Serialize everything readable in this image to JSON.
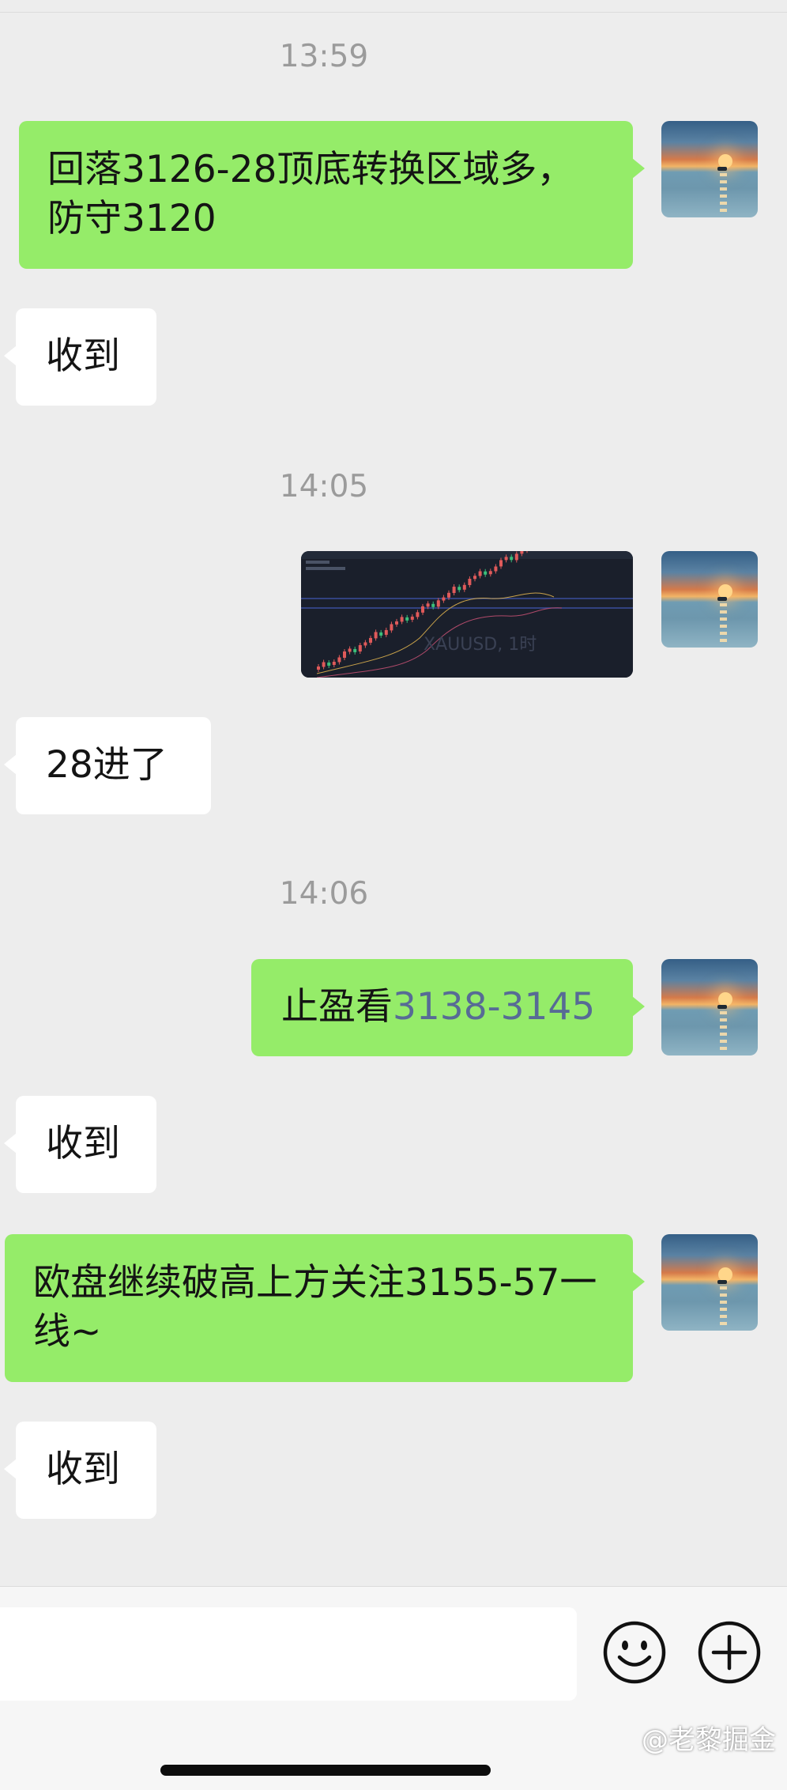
{
  "messages": [
    {
      "type": "time",
      "text": "13:59"
    },
    {
      "type": "outgoing",
      "text": "回落3126-28顶底转换区域多，防守3120"
    },
    {
      "type": "incoming",
      "text": "收到"
    },
    {
      "type": "time",
      "text": "14:05"
    },
    {
      "type": "outgoing-image",
      "symbol": "XAUUSD",
      "timeframe": "1时"
    },
    {
      "type": "incoming",
      "text": "28进了"
    },
    {
      "type": "time",
      "text": "14:06"
    },
    {
      "type": "outgoing",
      "text": "止盈看",
      "link": "3138-3145"
    },
    {
      "type": "incoming",
      "text": "收到"
    },
    {
      "type": "outgoing",
      "text": "欧盘继续破高上方关注3155-57一线~"
    },
    {
      "type": "incoming",
      "text": "收到"
    }
  ],
  "chart_image": {
    "label": "XAUUSD, 1时"
  },
  "bottom_bar": {
    "emoji_icon": "smiley-face-icon",
    "more_icon": "plus-circle-icon"
  },
  "watermark": "@老黎掘金",
  "colors": {
    "background": "#ededed",
    "outgoing_bubble": "#95ec69",
    "incoming_bubble": "#ffffff",
    "link": "#576b95",
    "timestamp": "#9b9b9b"
  }
}
